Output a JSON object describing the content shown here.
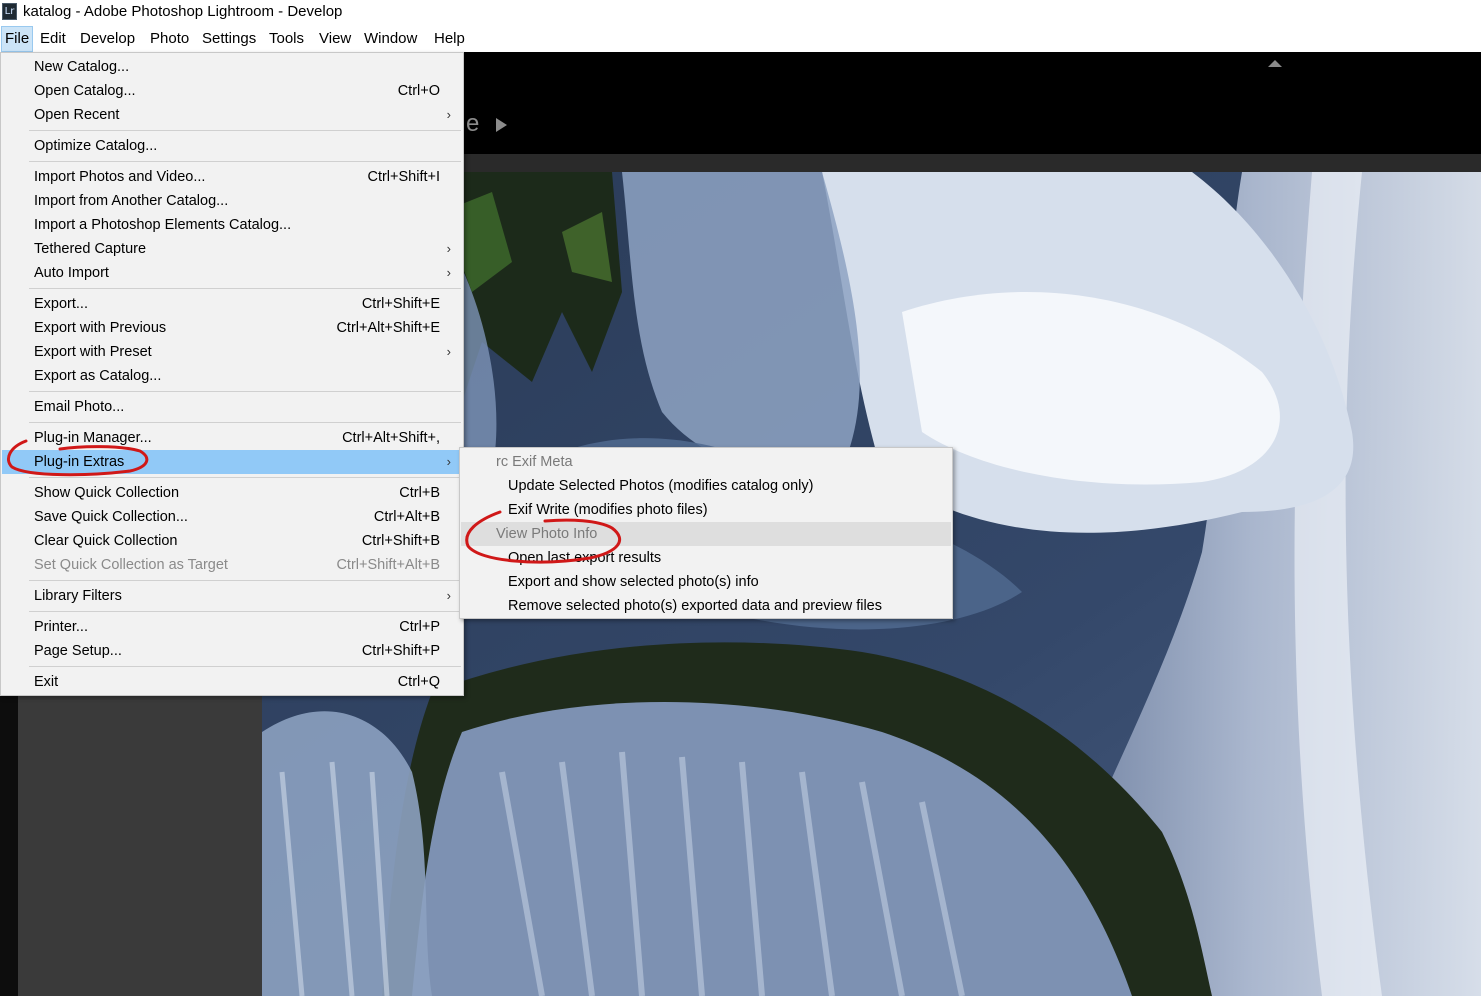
{
  "window": {
    "icon_text": "Lr",
    "title": "katalog - Adobe Photoshop Lightroom - Develop"
  },
  "menubar": [
    {
      "label": "File",
      "active": true
    },
    {
      "label": "Edit"
    },
    {
      "label": "Develop"
    },
    {
      "label": "Photo"
    },
    {
      "label": "Settings"
    },
    {
      "label": "Tools"
    },
    {
      "label": "View"
    },
    {
      "label": "Window"
    },
    {
      "label": "Help"
    }
  ],
  "module_fragment": "e",
  "file_menu": [
    {
      "label": "New Catalog...",
      "shortcut": ""
    },
    {
      "label": "Open Catalog...",
      "shortcut": "Ctrl+O"
    },
    {
      "label": "Open Recent",
      "shortcut": "",
      "submenu": true
    },
    {
      "label": "Optimize Catalog...",
      "shortcut": ""
    },
    {
      "label": "Import Photos and Video...",
      "shortcut": "Ctrl+Shift+I"
    },
    {
      "label": "Import from Another Catalog...",
      "shortcut": ""
    },
    {
      "label": "Import a Photoshop Elements Catalog...",
      "shortcut": ""
    },
    {
      "label": "Tethered Capture",
      "shortcut": "",
      "submenu": true
    },
    {
      "label": "Auto Import",
      "shortcut": "",
      "submenu": true
    },
    {
      "label": "Export...",
      "shortcut": "Ctrl+Shift+E"
    },
    {
      "label": "Export with Previous",
      "shortcut": "Ctrl+Alt+Shift+E"
    },
    {
      "label": "Export with Preset",
      "shortcut": "",
      "submenu": true
    },
    {
      "label": "Export as Catalog...",
      "shortcut": ""
    },
    {
      "label": "Email Photo...",
      "shortcut": ""
    },
    {
      "label": "Plug-in Manager...",
      "shortcut": "Ctrl+Alt+Shift+,"
    },
    {
      "label": "Plug-in Extras",
      "shortcut": "",
      "submenu": true,
      "highlighted": true
    },
    {
      "label": "Show Quick Collection",
      "shortcut": "Ctrl+B"
    },
    {
      "label": "Save Quick Collection...",
      "shortcut": "Ctrl+Alt+B"
    },
    {
      "label": "Clear Quick Collection",
      "shortcut": "Ctrl+Shift+B"
    },
    {
      "label": "Set Quick Collection as Target",
      "shortcut": "Ctrl+Shift+Alt+B",
      "disabled": true
    },
    {
      "label": "Library Filters",
      "shortcut": "",
      "submenu": true
    },
    {
      "label": "Printer...",
      "shortcut": "Ctrl+P"
    },
    {
      "label": "Page Setup...",
      "shortcut": "Ctrl+Shift+P"
    },
    {
      "label": "Exit",
      "shortcut": "Ctrl+Q"
    }
  ],
  "submenu": [
    {
      "label": "rc Exif Meta",
      "header": true
    },
    {
      "label": "Update Selected Photos (modifies catalog only)"
    },
    {
      "label": "Exif Write (modifies photo files)"
    },
    {
      "label": "View Photo Info",
      "disabled": true,
      "hovered": true
    },
    {
      "label": "Open last export results"
    },
    {
      "label": "Export and show selected photo(s) info"
    },
    {
      "label": "Remove selected photo(s) exported data and preview files"
    }
  ],
  "colors": {
    "menu_bg": "#f2f2f2",
    "menu_highlight": "#91c9f7",
    "menubar_active": "#cce4f7",
    "annotation": "#d01818",
    "app_bg": "#111111"
  }
}
